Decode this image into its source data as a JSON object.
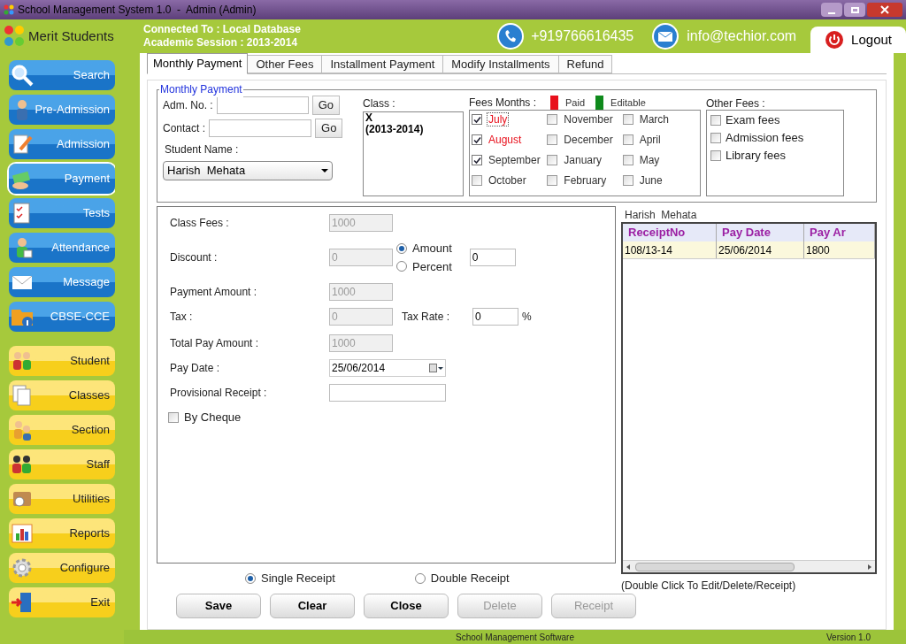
{
  "window": {
    "title": "School Management System 1.0  -  Admin (Admin)"
  },
  "app_name": "Merit Students",
  "connection": [
    "Connected To : Local Database",
    "Academic Session : 2013-2014"
  ],
  "contact": {
    "phone": "+919766616435",
    "email": "info@techior.com"
  },
  "logout": "Logout",
  "sidebar": {
    "items": [
      {
        "label": "Search",
        "kind": "blue",
        "selected": false
      },
      {
        "label": "Pre-Admission",
        "kind": "blue",
        "selected": false
      },
      {
        "label": "Admission",
        "kind": "blue",
        "selected": false
      },
      {
        "label": "Payment",
        "kind": "blue",
        "selected": true
      },
      {
        "label": "Tests",
        "kind": "blue",
        "selected": false
      },
      {
        "label": "Attendance",
        "kind": "blue",
        "selected": false
      },
      {
        "label": "Message",
        "kind": "blue",
        "selected": false
      },
      {
        "label": "CBSE-CCE",
        "kind": "blue",
        "selected": false
      },
      {
        "label": "Student",
        "kind": "yellow",
        "selected": false
      },
      {
        "label": "Classes",
        "kind": "yellow",
        "selected": false
      },
      {
        "label": "Section",
        "kind": "yellow",
        "selected": false
      },
      {
        "label": "Staff",
        "kind": "yellow",
        "selected": false
      },
      {
        "label": "Utilities",
        "kind": "yellow",
        "selected": false
      },
      {
        "label": "Reports",
        "kind": "yellow",
        "selected": false
      },
      {
        "label": "Configure",
        "kind": "yellow",
        "selected": false
      },
      {
        "label": "Exit",
        "kind": "yellow",
        "selected": false
      }
    ]
  },
  "tabs": [
    {
      "label": "Monthly Payment",
      "selected": true
    },
    {
      "label": "Other Fees",
      "selected": false
    },
    {
      "label": "Installment Payment",
      "selected": false
    },
    {
      "label": "Modify Installments",
      "selected": false
    },
    {
      "label": "Refund",
      "selected": false
    }
  ],
  "monthly_payment": {
    "legend": "Monthly Payment",
    "lookup": [
      {
        "label": "Adm. No. :",
        "button": "Go"
      },
      {
        "label": "Contact :",
        "button": "Go"
      }
    ],
    "student_name": {
      "label": "Student Name :",
      "value": "Harish  Mehata"
    },
    "class": {
      "label": "Class :",
      "lines": [
        "X",
        "(2013-2014)"
      ]
    },
    "fees_months": {
      "label": "Fees Months :",
      "legend": [
        {
          "label": "Paid",
          "color": "#e8101c"
        },
        {
          "label": "Editable",
          "color": "#0f8a1c"
        }
      ],
      "months": [
        {
          "label": "July",
          "checked": true,
          "paid": true,
          "focused": true
        },
        {
          "label": "August",
          "checked": true,
          "paid": true,
          "focused": false
        },
        {
          "label": "September",
          "checked": true,
          "paid": false,
          "focused": false
        },
        {
          "label": "October",
          "checked": false,
          "paid": false,
          "focused": false
        },
        {
          "label": "November",
          "checked": false,
          "paid": false,
          "focused": false
        },
        {
          "label": "December",
          "checked": false,
          "paid": false,
          "focused": false
        },
        {
          "label": "January",
          "checked": false,
          "paid": false,
          "focused": false
        },
        {
          "label": "February",
          "checked": false,
          "paid": false,
          "focused": false
        },
        {
          "label": "March",
          "checked": false,
          "paid": false,
          "focused": false
        },
        {
          "label": "April",
          "checked": false,
          "paid": false,
          "focused": false
        },
        {
          "label": "May",
          "checked": false,
          "paid": false,
          "focused": false
        },
        {
          "label": "June",
          "checked": false,
          "paid": false,
          "focused": false
        }
      ]
    },
    "other_fees": {
      "label": "Other Fees :",
      "items": [
        {
          "label": "Exam fees",
          "checked": false
        },
        {
          "label": "Admission fees",
          "checked": false
        },
        {
          "label": "Library fees",
          "checked": false
        }
      ]
    }
  },
  "payment": {
    "class_fees": {
      "label": "Class Fees :",
      "value": "1000"
    },
    "discount": {
      "label": "Discount :",
      "value": "0",
      "options": [
        {
          "label": "Amount",
          "selected": true
        },
        {
          "label": "Percent",
          "selected": false
        }
      ],
      "rate": "0"
    },
    "payment_amount": {
      "label": "Payment Amount :",
      "value": "1000"
    },
    "tax": {
      "label": "Tax :",
      "value": "0",
      "rate_label": "Tax Rate :",
      "rate": "0",
      "unit": "%"
    },
    "total_pay_amount": {
      "label": "Total Pay Amount :",
      "value": "1000"
    },
    "pay_date": {
      "label": "Pay Date :",
      "value": "25/06/2014"
    },
    "provisional_receipt": {
      "label": "Provisional Receipt :"
    },
    "by_cheque": {
      "label": "By Cheque",
      "checked": false
    }
  },
  "receipts": {
    "title": "Harish  Mehata",
    "columns": [
      "ReceiptNo",
      "Pay Date",
      "Pay Ar"
    ],
    "rows": [
      [
        "108/13-14",
        "25/06/2014",
        "1800"
      ]
    ],
    "hint": "(Double Click To Edit/Delete/Receipt)"
  },
  "receipt_type": [
    {
      "label": "Single Receipt",
      "selected": true
    },
    {
      "label": "Double Receipt",
      "selected": false
    }
  ],
  "buttons": [
    {
      "label": "Save",
      "disabled": false
    },
    {
      "label": "Clear",
      "disabled": false
    },
    {
      "label": "Close",
      "disabled": false
    },
    {
      "label": "Delete",
      "disabled": true
    },
    {
      "label": "Receipt",
      "disabled": true
    }
  ],
  "status_bar": {
    "center": "School Management Software",
    "version": "Version 1.0"
  }
}
